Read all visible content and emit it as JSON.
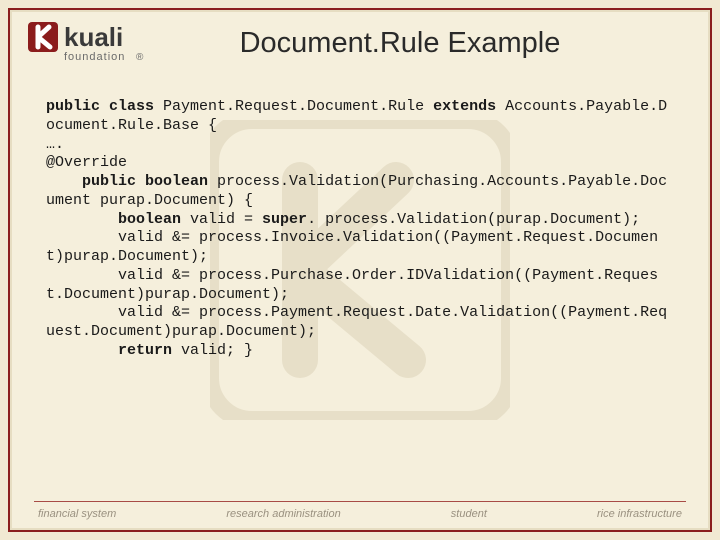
{
  "brand": {
    "name": "kuali",
    "sub": "foundation",
    "reg": "®"
  },
  "title": "Document.Rule Example",
  "code": {
    "l1a": "public class ",
    "l1b": "Payment.Request.Document.Rule ",
    "l1c": "extends ",
    "l2": "Accounts.Payable.Document.Rule.Base {",
    "l3": "….",
    "l4": "@Override",
    "l5a": "public boolean",
    "l5b": " process.Validation(Purchasing.Accounts.Payable.Document purap.Document) {",
    "l6a": "boolean",
    "l6b": " valid = ",
    "l6c": "super",
    "l6d": ". process.Validation(purap.Document);",
    "l7": "        valid &= process.Invoice.Validation((Payment.Request.Document)purap.Document);",
    "l8": "        valid &= process.Purchase.Order.IDValidation((Payment.Request.Document)purap.Document);",
    "l9": "        valid &= process.Payment.Request.Date.Validation((Payment.Request.Document)purap.Document);",
    "l10a": "return",
    "l10b": " valid; }"
  },
  "footer": {
    "items": [
      "financial system",
      "research administration",
      "student",
      "rice infrastructure"
    ]
  }
}
